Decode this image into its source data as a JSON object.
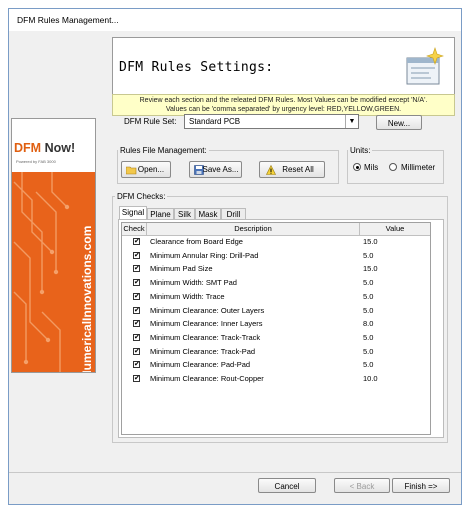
{
  "window": {
    "title": "DFM Rules Management..."
  },
  "header": {
    "heading": "DFM Rules Settings:",
    "notice_line1": "Review each section and the releated DFM Rules. Most Values can be modified except 'N/A'.",
    "notice_line2": "Values can be 'comma separated' by urgency level: RED,YELLOW,GREEN."
  },
  "banner": {
    "logo_part1": "DFM ",
    "logo_part2": "Now!",
    "sub": "Powered by FAB 3000",
    "vertical_text": "NumericalInnovations.com"
  },
  "rule_set": {
    "label": "DFM Rule Set:",
    "selected": "Standard PCB",
    "new_button": "New..."
  },
  "file_mgmt": {
    "group_label": "Rules File Management:",
    "open_button": "Open...",
    "save_as_button": "Save As...",
    "reset_button": "Reset All"
  },
  "units": {
    "group_label": "Units:",
    "mils": "Mils",
    "millimeter": "Millimeter",
    "selected": "Mils"
  },
  "checks": {
    "group_label": "DFM Checks:",
    "tabs": [
      "Signal",
      "Plane",
      "Silk",
      "Mask",
      "Drill"
    ],
    "active_tab": "Signal",
    "columns": {
      "check": "Check",
      "description": "Description",
      "value": "Value"
    },
    "rows": [
      {
        "description": "Clearance from Board Edge",
        "value": "15.0",
        "checked": true
      },
      {
        "description": "Minimum Annular Ring: Drill-Pad",
        "value": "5.0",
        "checked": true
      },
      {
        "description": "Minimum Pad Size",
        "value": "15.0",
        "checked": true
      },
      {
        "description": "Minimum Width: SMT Pad",
        "value": "5.0",
        "checked": true
      },
      {
        "description": "Minimum Width: Trace",
        "value": "5.0",
        "checked": true
      },
      {
        "description": "Minimum Clearance: Outer Layers",
        "value": "5.0",
        "checked": true
      },
      {
        "description": "Minimum Clearance: Inner Layers",
        "value": "8.0",
        "checked": true
      },
      {
        "description": "Minimum Clearance: Track-Track",
        "value": "5.0",
        "checked": true
      },
      {
        "description": "Minimum Clearance: Track-Pad",
        "value": "5.0",
        "checked": true
      },
      {
        "description": "Minimum Clearance: Pad-Pad",
        "value": "5.0",
        "checked": true
      },
      {
        "description": "Minimum Clearance: Rout-Copper",
        "value": "10.0",
        "checked": true
      }
    ]
  },
  "footer": {
    "cancel": "Cancel",
    "back": "< Back",
    "finish": "Finish  =>"
  },
  "colors": {
    "banner_orange": "#e8631b",
    "notice_bg": "#ffffc8"
  }
}
